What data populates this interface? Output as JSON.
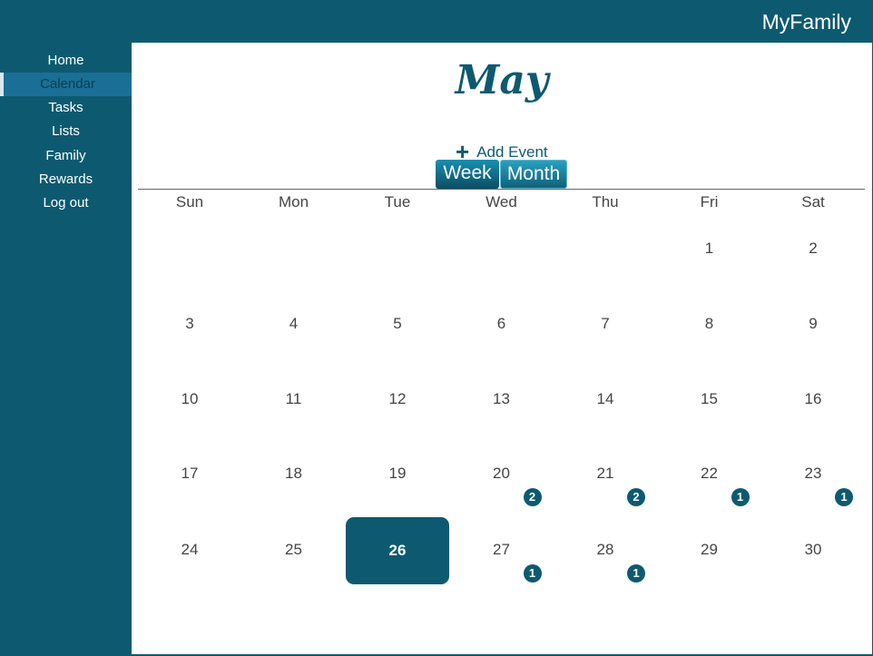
{
  "header": {
    "brand": "MyFamily"
  },
  "sidebar": {
    "items": [
      {
        "label": "Home"
      },
      {
        "label": "Calendar"
      },
      {
        "label": "Tasks"
      },
      {
        "label": "Lists"
      },
      {
        "label": "Family"
      },
      {
        "label": "Rewards"
      },
      {
        "label": "Log out"
      }
    ],
    "active": "Calendar"
  },
  "calendar": {
    "month": "May",
    "add_event_label": "Add Event",
    "views": {
      "week": "Week",
      "month": "Month"
    },
    "weekdays": [
      "Sun",
      "Mon",
      "Tue",
      "Wed",
      "Thu",
      "Fri",
      "Sat"
    ],
    "weeks": [
      [
        "",
        "",
        "",
        "",
        "",
        "1",
        "2"
      ],
      [
        "3",
        "4",
        "5",
        "6",
        "7",
        "8",
        "9"
      ],
      [
        "10",
        "11",
        "12",
        "13",
        "14",
        "15",
        "16"
      ],
      [
        "17",
        "18",
        "19",
        "20",
        "21",
        "22",
        "23"
      ],
      [
        "24",
        "25",
        "26",
        "27",
        "28",
        "29",
        "30"
      ]
    ],
    "today": "26",
    "event_counts": [
      {
        "day": "20",
        "count": "2"
      },
      {
        "day": "21",
        "count": "2"
      },
      {
        "day": "22",
        "count": "1"
      },
      {
        "day": "23",
        "count": "1"
      },
      {
        "day": "27",
        "count": "1"
      },
      {
        "day": "28",
        "count": "1"
      }
    ]
  },
  "colors": {
    "primary": "#0d5a70",
    "active_nav": "#1a6f96",
    "background": "#ffffff"
  }
}
